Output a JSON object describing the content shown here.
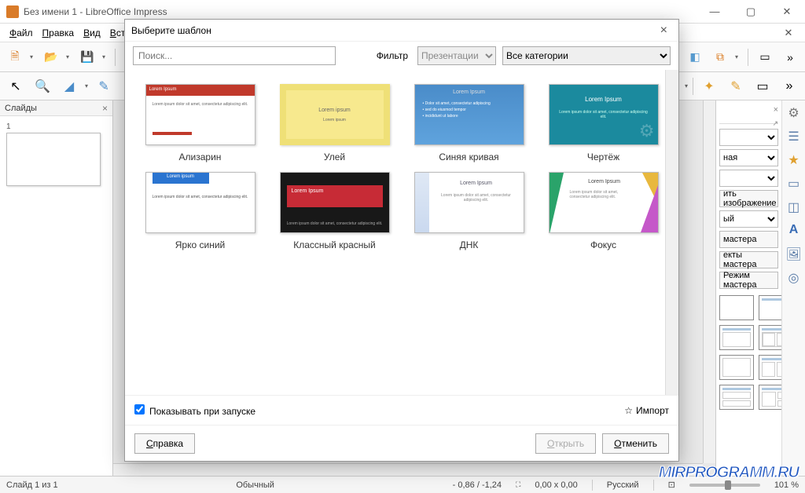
{
  "titlebar": {
    "title": "Без имени 1 - LibreOffice Impress"
  },
  "menubar": [
    "Файл",
    "Правка",
    "Вид",
    "Встав..."
  ],
  "slides_panel": {
    "title": "Слайды",
    "thumb_num": "1"
  },
  "rightpanel": {
    "combo_visible": "ная",
    "btn1": "ить изображение",
    "combo2": "ый",
    "btn2": "мастера",
    "btn3": "екты мастера",
    "btn4": "Режим мастера"
  },
  "statusbar": {
    "slide": "Слайд 1 из 1",
    "mode": "Обычный",
    "coords": "- 0,86 / -1,24",
    "size": "0,00 x 0,00",
    "lang": "Русский",
    "zoom": "101 %"
  },
  "dialog": {
    "title": "Выберите шаблон",
    "search_placeholder": "Поиск...",
    "filter_label": "Фильтр",
    "filter_sel": "Презентации",
    "cat_sel": "Все категории",
    "show_on_startup": "Показывать при запуске",
    "import": "Импорт",
    "help": "Справка",
    "open": "Открыть",
    "cancel": "Отменить",
    "templates": [
      {
        "name": "Ализарин"
      },
      {
        "name": "Улей"
      },
      {
        "name": "Синяя кривая"
      },
      {
        "name": "Чертёж"
      },
      {
        "name": "Ярко синий"
      },
      {
        "name": "Классный красный"
      },
      {
        "name": "ДНК"
      },
      {
        "name": "Фокус"
      }
    ],
    "lorem_title": "Lorem Ipsum",
    "lorem_low": "Lorem ipsum",
    "lorem_body": "Lorem ipsum dolor sit amet, consectetur adipiscing elit."
  },
  "watermark": "MIRPROGRAMM.RU"
}
